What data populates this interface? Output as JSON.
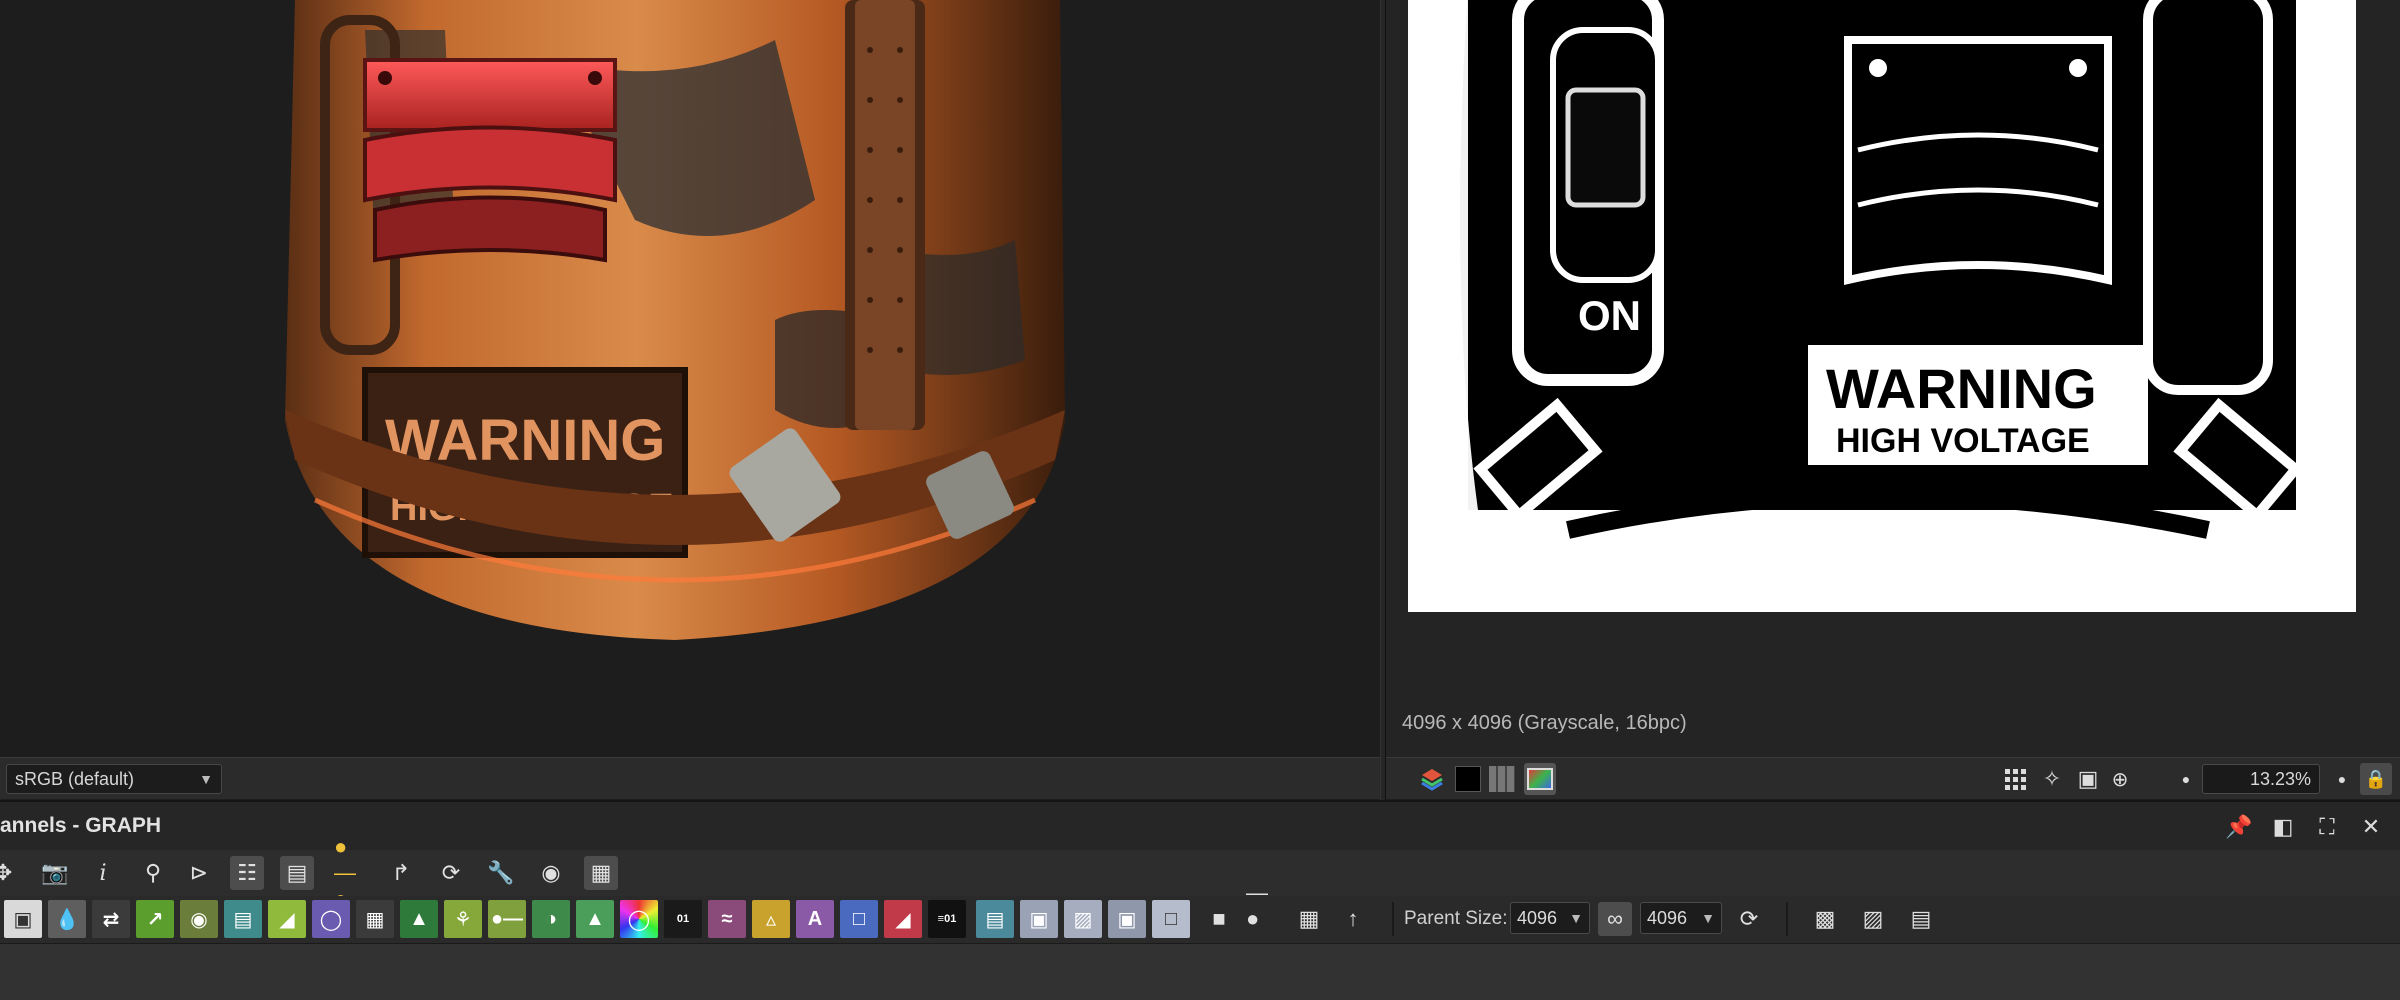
{
  "viewport3d": {
    "colorspace": {
      "value": "sRGB (default)"
    },
    "decal": {
      "line1": "WARNING",
      "line2": "HIGH VOLTAGE"
    }
  },
  "viewport2d": {
    "resolution_label": "4096 x 4096 (Grayscale, 16bpc)",
    "zoom": "13.23%",
    "map": {
      "button_text": "ON",
      "sign_line1": "WARNING",
      "sign_line2": "HIGH VOLTAGE"
    }
  },
  "graph": {
    "title": "annels - GRAPH",
    "parent_size_label": "Parent Size:",
    "width_value": "4096",
    "height_value": "4096"
  },
  "icons": {
    "pin": "pin-icon",
    "float": "float-icon",
    "maximize": "maximize-icon",
    "close": "close-icon"
  },
  "colors": {
    "panel_bg": "#2b2b2b",
    "viewport_bg": "#1d1d1d",
    "rust": "#c8672c",
    "red_tag": "#e0393c"
  }
}
